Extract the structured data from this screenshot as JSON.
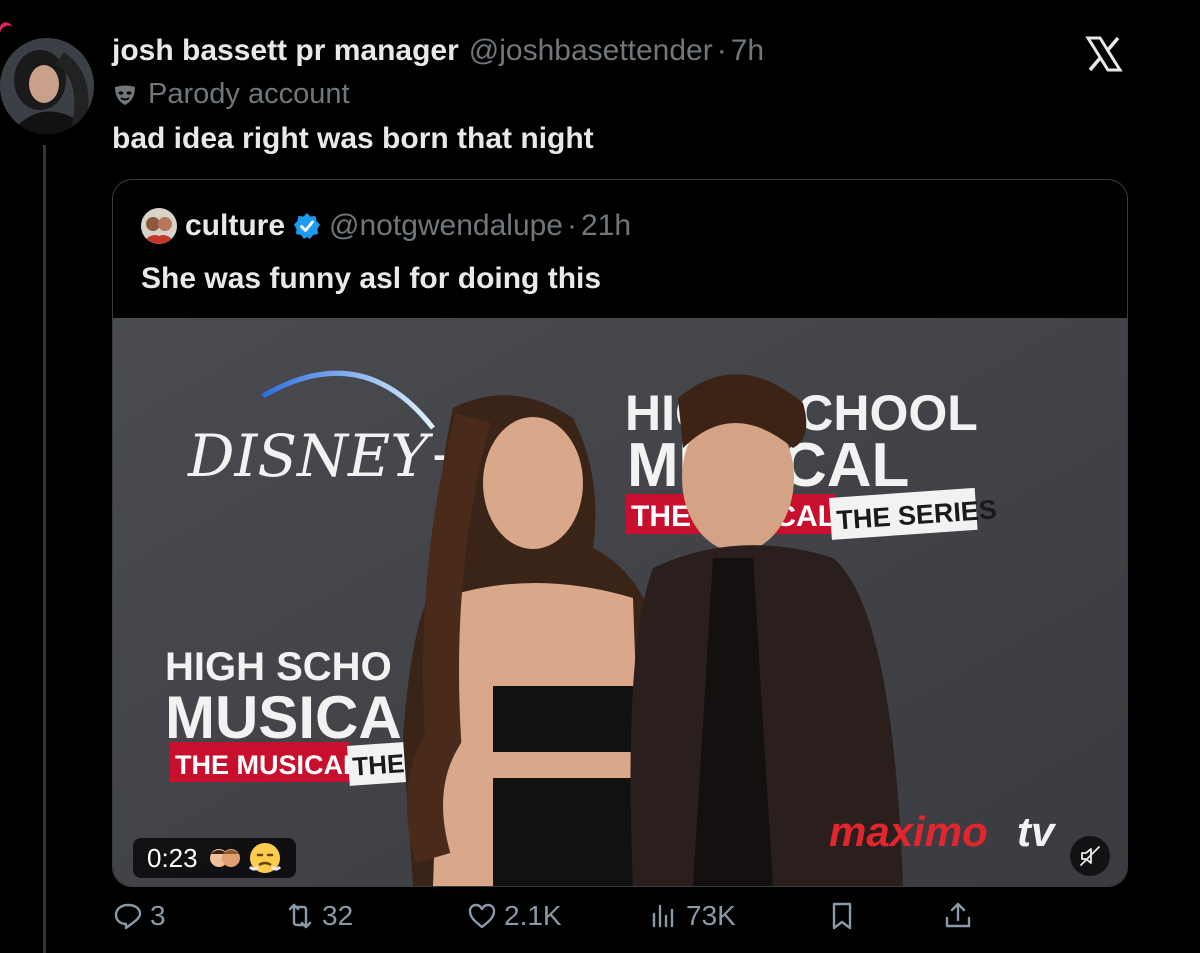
{
  "tweet": {
    "display_name": "josh bassett pr manager",
    "handle": "@joshbasettender",
    "separator": "·",
    "time": "7h",
    "label": "Parody account",
    "text": "bad idea right was born that night"
  },
  "quote": {
    "display_name": "culture",
    "handle": "@notgwendalupe",
    "separator": "·",
    "time": "21h",
    "text": "She was funny asl for doing this"
  },
  "video": {
    "duration": "0:23",
    "backdrop": {
      "disney_plus": "DISNEY+",
      "hsm_title_1": "HIGH SCHOOL",
      "hsm_title_2": "MUSICAL",
      "hsm_sub": "THE MUSICAL",
      "hsm_series": "THE SERIES",
      "hsm_left_1": "HIGH SCHO",
      "hsm_left_2": "MUSICA",
      "hsm_left_sub": "THE MUSICAL",
      "hsm_left_series": "THE S",
      "watermark_1": "maximo",
      "watermark_2": "tv"
    }
  },
  "actions": {
    "replies": "3",
    "reposts": "32",
    "likes": "2.1K",
    "views": "73K"
  },
  "colors": {
    "background": "#000000",
    "text": "#e7e9ea",
    "muted": "#71767b",
    "verified": "#1d9bf0",
    "watermark": "#e3262d"
  }
}
